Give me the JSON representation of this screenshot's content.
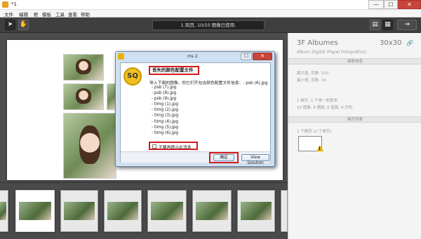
{
  "window": {
    "title": "*1",
    "minimize": "—",
    "maximize": "☐",
    "close": "✕"
  },
  "menu": [
    "文件",
    "编辑",
    "框",
    "模板",
    "工具",
    "查看",
    "帮助"
  ],
  "toolbar": {
    "status": "1 跨页, 10/10 图像已使用.",
    "arrow_icon": "cursor-arrow-icon",
    "hand_icon": "hand-icon"
  },
  "sidepanel": {
    "title": "3F Albumes",
    "size": "30x30",
    "link_icon": "link-icon",
    "subtitle": "Álbum Digital (Papel Fotográfico)",
    "section1": "相册信息",
    "info_max_pages": "最大值, 页数: 100",
    "info_min_pages": "最小值, 页数: 10",
    "spread_info": "1 跨页: 1 个单一的版本.",
    "image_info": "10 图像: 6 横版, 0 直版, 4 方形.",
    "section2": "跨页列表",
    "spread_label": "1 个跨页 (2 个单页)",
    "status_line": ""
  },
  "dialog": {
    "title": "ms 2",
    "heading": "丢失的颜色配置文件",
    "message": "导入下面的图像，但它们不包含颜色配置文件信息：- psb (6).jpg",
    "files": [
      "- psb (7).jpg",
      "- psb (8).jpg",
      "- psb (9).jpg",
      "- timg (1).jpg",
      "- timg (2).jpg",
      "- timg (3).jpg",
      "- timg (4).jpg",
      "- timg (5).jpg",
      "- timg (6).jpg"
    ],
    "checkbox_label": "不要再提示此消息",
    "ok_label": "确定",
    "view_solution_label": "View Solution",
    "logo": "SQ"
  },
  "colors": {
    "toolbar_bg": "#3f3f3f",
    "highlight": "#d21a1a",
    "dialog_frame": "#cfe0f2"
  }
}
